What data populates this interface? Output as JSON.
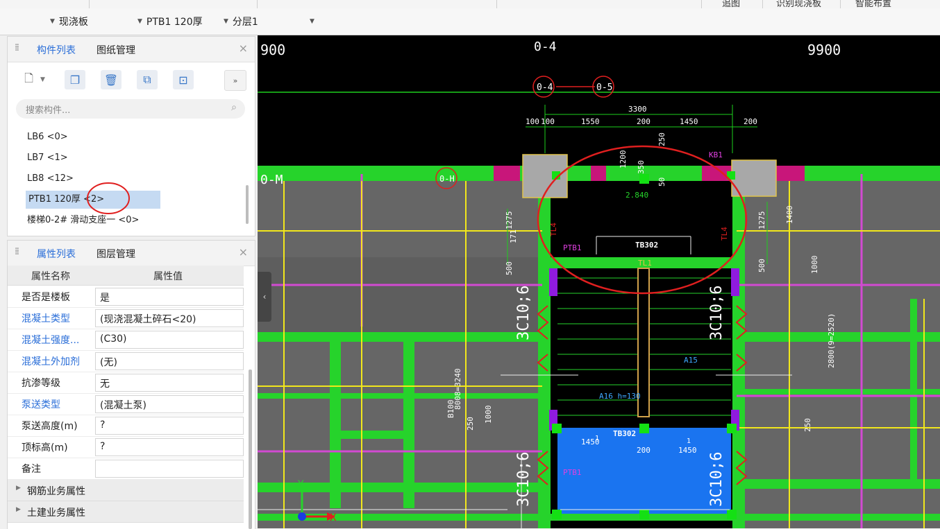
{
  "top_toolbar": {
    "buttons": [
      "追图",
      "识别现浇板",
      "智能布置"
    ]
  },
  "selectors": {
    "category": "现浇板",
    "component": "PTB1 120厚",
    "layer": "分层1"
  },
  "component_panel": {
    "tabs": [
      "构件列表",
      "图纸管理"
    ],
    "active_tab": "构件列表",
    "search_placeholder": "搜索构件...",
    "items": [
      {
        "label": "LB6 <0>"
      },
      {
        "label": "LB7 <1>"
      },
      {
        "label": "LB8 <12>"
      },
      {
        "label": "PTB1 120厚 <2>",
        "selected": true
      },
      {
        "label": "楼梯0-2# 滑动支座一 <0>"
      }
    ]
  },
  "property_panel": {
    "tabs": [
      "属性列表",
      "图层管理"
    ],
    "active_tab": "属性列表",
    "header_name": "属性名称",
    "header_value": "属性值",
    "rows": [
      {
        "name": "是否是楼板",
        "value": "是"
      },
      {
        "name": "混凝土类型",
        "value": "(现浇混凝土碎石<20)"
      },
      {
        "name": "混凝土强度...",
        "value": "(C30)"
      },
      {
        "name": "混凝土外加剂",
        "value": "(无)"
      },
      {
        "name": "抗渗等级",
        "value": "无"
      },
      {
        "name": "泵送类型",
        "value": "(混凝土泵)"
      },
      {
        "name": "泵送高度(m)",
        "value": "?"
      },
      {
        "name": "顶标高(m)",
        "value": "?"
      },
      {
        "name": "备注",
        "value": ""
      }
    ],
    "groups": [
      "钢筋业务属性",
      "土建业务属性"
    ]
  },
  "drawing": {
    "axis_labels": [
      "0-4",
      "0-4",
      "0-5",
      "0-M",
      "0-H"
    ],
    "dimensions_top": [
      "900",
      "9900",
      "3300",
      "100",
      "100",
      "1550",
      "200",
      "1450",
      "200"
    ],
    "dim_vertical": [
      "1275",
      "171",
      "500",
      "1275",
      "500",
      "1400",
      "1200",
      "350",
      "50",
      "250"
    ],
    "labels": [
      "PTB1",
      "TB302",
      "TL4",
      "TL4",
      "PTB1",
      "TL1",
      "2.840",
      "3C10;6",
      "3C10;6",
      "3C10;6",
      "3C10;6",
      "A16 h=130",
      "A15",
      "KB1",
      "TB302"
    ],
    "bottom_dims": [
      "1450",
      "200",
      "1450",
      "1",
      "1"
    ],
    "side_notes": [
      "B100",
      "8008=3240",
      "250",
      "1000",
      "2800(9=2520)",
      "250",
      "1000"
    ],
    "axis_x": "X",
    "axis_y": "Y"
  }
}
